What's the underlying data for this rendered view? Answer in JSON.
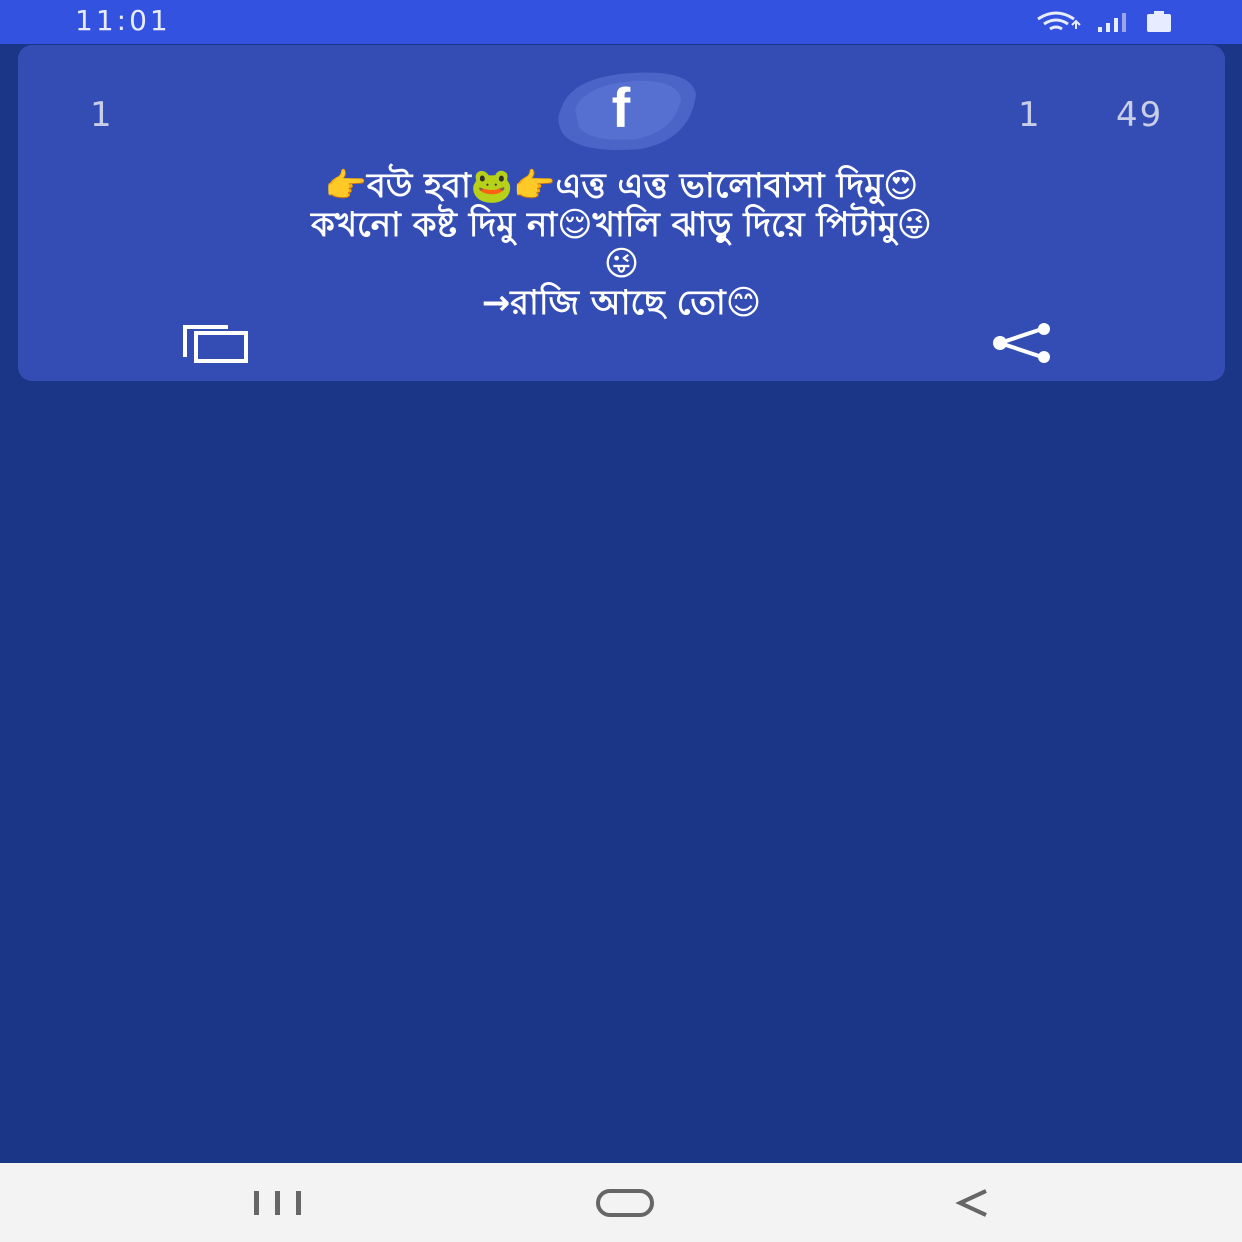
{
  "status_bar": {
    "time": "11:01",
    "icons": [
      "wifi-icon",
      "signal-icon",
      "battery-icon"
    ]
  },
  "card": {
    "count_left": "1",
    "count_mid": "1",
    "count_right": "49",
    "badge_letter": "f",
    "quote_lines": [
      "👉বউ হবা🐸👉এত্ত এত্ত ভালোবাসা দিমু😍",
      "কখনো কষ্ট দিমু না😌খালি ঝাড়ু দিয়ে পিটামু😜",
      "😜",
      "→রাজি আছে তো😊"
    ],
    "actions": [
      "copy-icon",
      "share-icon"
    ]
  },
  "nav_bar": {
    "buttons": [
      "recent-apps-icon",
      "home-icon",
      "back-icon"
    ]
  },
  "colors": {
    "background": "#1b3687",
    "status_bar": "#3352e0",
    "card": "#344db4",
    "nav_bar": "#f3f3f3"
  }
}
